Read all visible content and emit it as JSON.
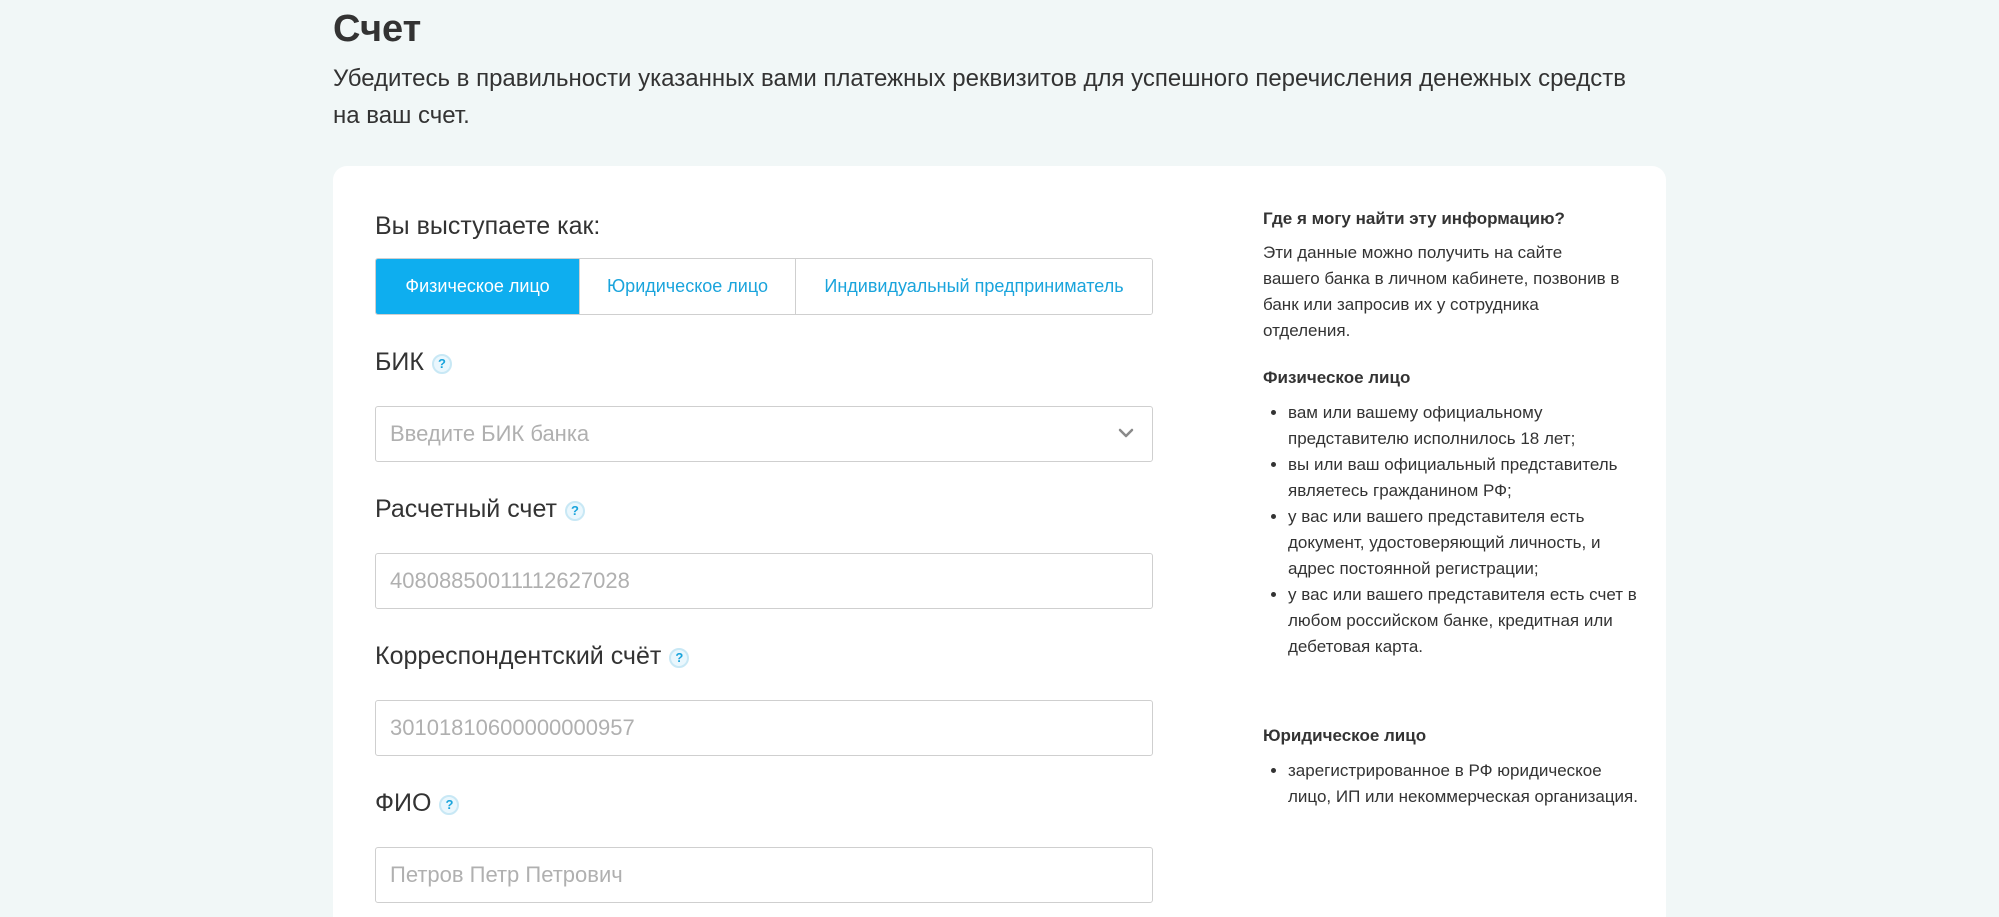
{
  "header": {
    "title": "Счет",
    "description": "Убедитесь в правильности указанных вами платежных реквизитов для успешного перечисления денежных средств на ваш счет."
  },
  "form": {
    "role_question": "Вы выступаете как:",
    "role_options": [
      {
        "label": "Физическое лицо",
        "active": true
      },
      {
        "label": "Юридическое лицо",
        "active": false
      },
      {
        "label": "Индивидуальный предприниматель",
        "active": false
      }
    ],
    "bik": {
      "label": "БИК",
      "placeholder": "Введите БИК банка",
      "help": "?"
    },
    "account": {
      "label": "Расчетный счет",
      "placeholder": "40808850011112627028",
      "help": "?"
    },
    "corr_account": {
      "label": "Корреспондентский счёт",
      "placeholder": "30101810600000000957",
      "help": "?"
    },
    "fio": {
      "label": "ФИО",
      "placeholder": "Петров Петр Петрович",
      "help": "?"
    }
  },
  "sidebar": {
    "title": "Где я могу найти эту информацию?",
    "intro": "Эти данные можно получить на сайте вашего банка в личном кабинете, позвонив в банк или запросив их у сотрудника отделения.",
    "individual": {
      "title": "Физическое лицо",
      "items": [
        "вам или вашему официальному представителю исполнилось 18 лет;",
        "вы или ваш официальный представитель являетесь гражданином РФ;",
        "у вас или вашего представителя есть документ, удостоверяющий личность, и адрес постоянной регистрации;",
        "у вас или вашего представителя есть счет в любом российском банке, кредитная или дебетовая карта."
      ]
    },
    "legal": {
      "title": "Юридическое лицо",
      "items": [
        "зарегистрированное в РФ юридическое лицо, ИП или некоммерческая организация."
      ]
    }
  },
  "colors": {
    "background": "#f1f7f7",
    "accent": "#0eaeef",
    "link": "#1aa4dc"
  }
}
